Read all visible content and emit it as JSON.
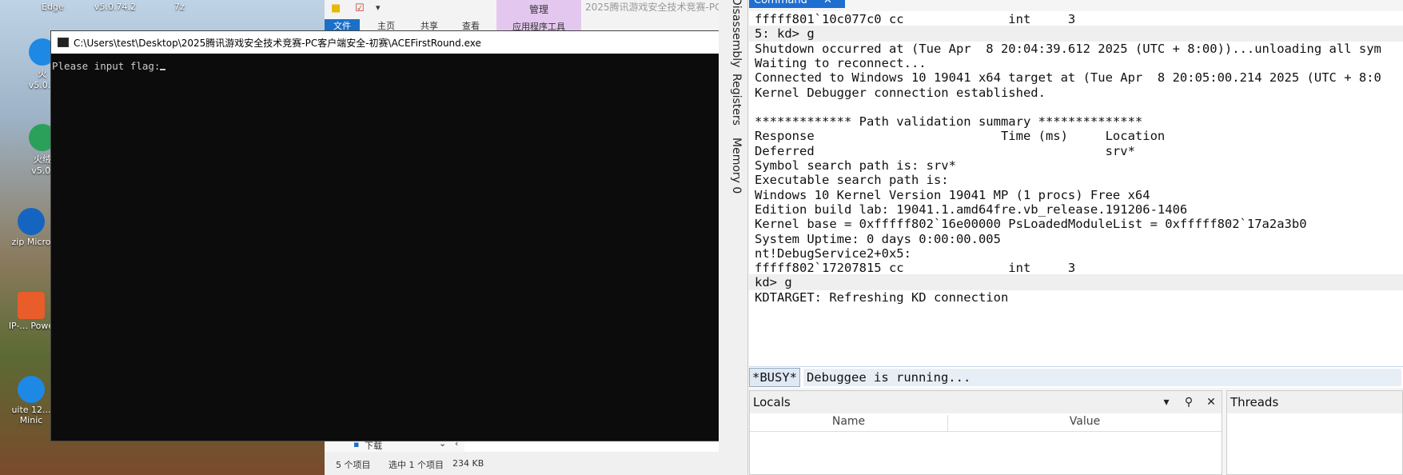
{
  "desktop": {
    "top_labels": [
      "Edge",
      "v5.0.74.2",
      "7z"
    ],
    "icons": [
      {
        "label": "v5.0.7",
        "partial": "火"
      },
      {
        "label": "v5.0.",
        "partial": "火绒"
      },
      {
        "label": "Micro",
        "partial": "zip"
      },
      {
        "label": "Powe",
        "partial": "IP-..."
      },
      {
        "label": "Minic",
        "partial": "uite 12..."
      }
    ]
  },
  "explorer": {
    "title": "2025腾讯游戏安全技术竞赛-PC",
    "tabs": {
      "file": "文件",
      "home": "主页",
      "share": "共享",
      "view": "查看"
    },
    "manage": "管理",
    "app_tools": "应用程序工具",
    "subfolder": "下载",
    "status": {
      "items": "5 个项目",
      "selected": "选中 1 个项目",
      "size": "234 KB"
    }
  },
  "console": {
    "title": "C:\\Users\\test\\Desktop\\2025腾讯游戏安全技术竞赛-PC客户端安全-初赛\\ACEFirstRound.exe",
    "prompt": "Please input flag:"
  },
  "windbg": {
    "side_tabs": [
      "Disassembly",
      "Registers",
      "Memory 0"
    ],
    "command_tab": "Command",
    "lines": [
      "fffff801`10c077c0 cc              int     3",
      "5: kd> g",
      "Shutdown occurred at (Tue Apr  8 20:04:39.612 2025 (UTC + 8:00))...unloading all sym",
      "Waiting to reconnect...",
      "Connected to Windows 10 19041 x64 target at (Tue Apr  8 20:05:00.214 2025 (UTC + 8:0",
      "Kernel Debugger connection established.",
      "",
      "************* Path validation summary **************",
      "Response                         Time (ms)     Location",
      "Deferred                                       srv*",
      "Symbol search path is: srv*",
      "Executable search path is:",
      "Windows 10 Kernel Version 19041 MP (1 procs) Free x64",
      "Edition build lab: 19041.1.amd64fre.vb_release.191206-1406",
      "Kernel base = 0xfffff802`16e00000 PsLoadedModuleList = 0xfffff802`17a2a3b0",
      "System Uptime: 0 days 0:00:00.005",
      "nt!DebugService2+0x5:",
      "fffff802`17207815 cc              int     3",
      "kd> g",
      "KDTARGET: Refreshing KD connection"
    ],
    "highlighted": [
      1,
      18
    ],
    "busy_label": "*BUSY*",
    "busy_message": "Debuggee is running...",
    "locals": {
      "title": "Locals",
      "col_name": "Name",
      "col_value": "Value"
    },
    "threads": {
      "title": "Threads"
    }
  }
}
